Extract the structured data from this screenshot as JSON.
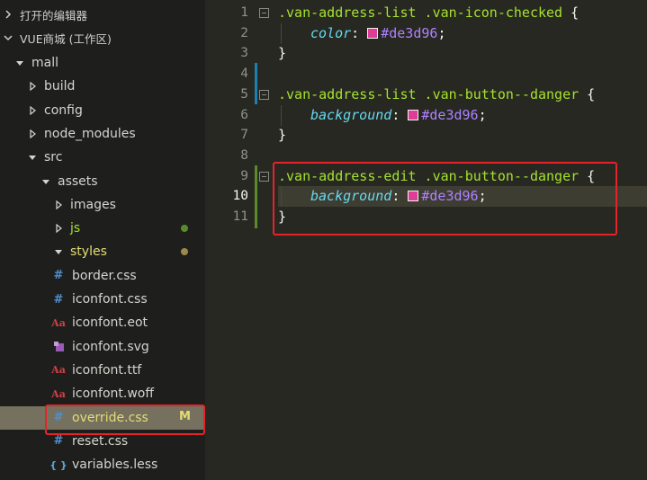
{
  "sidebar": {
    "open_editors": "打开的编辑器",
    "workspace": "VUE商城 (工作区)",
    "tree": [
      {
        "label": "mall",
        "type": "folder-open",
        "depth": 0
      },
      {
        "label": "build",
        "type": "folder",
        "depth": 1
      },
      {
        "label": "config",
        "type": "folder",
        "depth": 1
      },
      {
        "label": "node_modules",
        "type": "folder",
        "depth": 1
      },
      {
        "label": "src",
        "type": "folder-open",
        "depth": 1
      },
      {
        "label": "assets",
        "type": "folder-open",
        "depth": 2
      },
      {
        "label": "images",
        "type": "folder",
        "depth": 3
      },
      {
        "label": "js",
        "type": "folder",
        "depth": 3
      },
      {
        "label": "styles",
        "type": "folder-open",
        "depth": 3
      },
      {
        "label": "border.css",
        "type": "file",
        "icon": "hash-icon",
        "depth": 4
      },
      {
        "label": "iconfont.css",
        "type": "file",
        "icon": "hash-icon",
        "depth": 4
      },
      {
        "label": "iconfont.eot",
        "type": "file",
        "icon": "font-icon",
        "depth": 4
      },
      {
        "label": "iconfont.svg",
        "type": "file",
        "icon": "svg-icon",
        "depth": 4
      },
      {
        "label": "iconfont.ttf",
        "type": "file",
        "icon": "font-icon",
        "depth": 4
      },
      {
        "label": "iconfont.woff",
        "type": "file",
        "icon": "font-icon",
        "depth": 4
      },
      {
        "label": "override.css",
        "type": "file",
        "icon": "hash-icon",
        "depth": 4,
        "badge": "M",
        "selected": true
      },
      {
        "label": "reset.css",
        "type": "file",
        "icon": "hash-icon",
        "depth": 4
      },
      {
        "label": "variables.less",
        "type": "file",
        "icon": "braces-icon",
        "depth": 4
      }
    ],
    "modified_badge": "M"
  },
  "editor": {
    "active_line": "10",
    "lines": [
      {
        "n": "1",
        "sel": ".van-address-list .van-icon-checked",
        "open": " {"
      },
      {
        "n": "2",
        "prop": "color",
        "val": "#de3d96"
      },
      {
        "n": "3",
        "close": "}"
      },
      {
        "n": "4"
      },
      {
        "n": "5",
        "sel": ".van-address-list .van-button--danger",
        "open": " {"
      },
      {
        "n": "6",
        "prop": "background",
        "val": "#de3d96"
      },
      {
        "n": "7",
        "close": "}"
      },
      {
        "n": "8"
      },
      {
        "n": "9",
        "sel": ".van-address-edit .van-button--danger",
        "open": " {"
      },
      {
        "n": "10",
        "prop": "background",
        "val": "#de3d96"
      },
      {
        "n": "11",
        "close": "}"
      }
    ],
    "swatch_color": "#de3d96"
  },
  "colors": {
    "selector": "#a6e22e",
    "property": "#66d9ef",
    "value": "#ae81ff",
    "highlight_box": "#e5242a",
    "git_modified_bar": "#1e7fb3",
    "git_added_bar": "#5a8a2e"
  }
}
